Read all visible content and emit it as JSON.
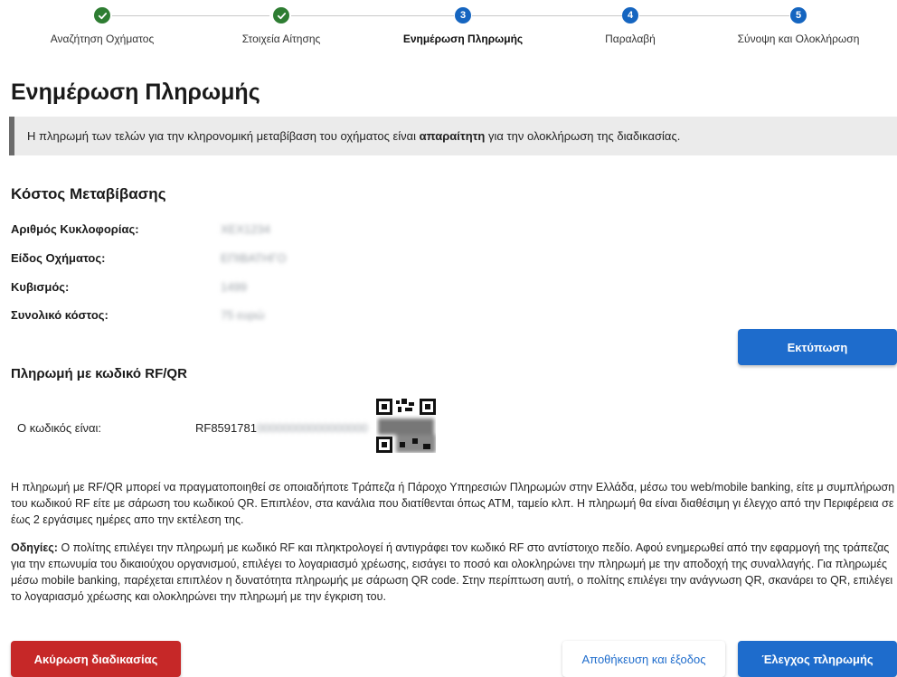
{
  "stepper": {
    "steps": [
      {
        "label": "Αναζήτηση Οχήματος",
        "state": "done",
        "number": "1"
      },
      {
        "label": "Στοιχεία Αίτησης",
        "state": "done",
        "number": "2"
      },
      {
        "label": "Ενημέρωση Πληρωμής",
        "state": "active",
        "number": "3"
      },
      {
        "label": "Παραλαβή",
        "state": "todo",
        "number": "4"
      },
      {
        "label": "Σύνοψη και Ολοκλήρωση",
        "state": "todo",
        "number": "5"
      }
    ]
  },
  "page": {
    "title": "Ενημέρωση Πληρωμής"
  },
  "banner": {
    "text_before": "Η πληρωμή των τελών για την κληρονομική μεταβίβαση του οχήματος είναι ",
    "text_bold": "απαραίτητη",
    "text_after": " για την ολοκλήρωση της διαδικασίας."
  },
  "cost": {
    "title": "Κόστος Μεταβίβασης",
    "rows": [
      {
        "label": "Αριθμός Κυκλοφορίας:",
        "value": "ΧΕΧ1234"
      },
      {
        "label": "Είδος Οχήματος:",
        "value": "ΕΠΙΒΑΤΗΓΟ"
      },
      {
        "label": "Κυβισμός:",
        "value": "1499"
      },
      {
        "label": "Συνολικό κόστος:",
        "value": "75 ευρώ"
      }
    ]
  },
  "buttons": {
    "print": "Εκτύπωση",
    "cancel": "Ακύρωση διαδικασίας",
    "save_exit": "Αποθήκευση και έξοδος",
    "check_payment": "Έλεγχος πληρωμής"
  },
  "rf": {
    "title": "Πληρωμή με κωδικό RF/QR",
    "label": "Ο κωδικός είναι:",
    "code_visible": "RF8591781",
    "code_hidden": "00000000000000000"
  },
  "paragraphs": {
    "p1": "Η πληρωμή με RF/QR μπορεί να πραγματοποιηθεί σε οποιαδήποτε Τράπεζα ή Πάροχο Υπηρεσιών Πληρωμών στην Ελλάδα, μέσω του web/mobile banking, είτε μ συμπλήρωση του κωδικού RF είτε με σάρωση του κωδικού QR. Επιπλέον, στα κανάλια που διατίθενται όπως ΑΤΜ, ταμείο κλπ. Η πληρωμή θα είναι διαθέσιμη γι έλεγχο από την Περιφέρεια σε έως 2 εργάσιμες ημέρες απο την εκτέλεση της.",
    "p2_bold": "Οδηγίες:",
    "p2": " Ο πολίτης επιλέγει την πληρωμή με κωδικό RF και πληκτρολογεί ή αντιγράφει τον κωδικό RF στο αντίστοιχο πεδίο. Αφού ενημερωθεί από την εφαρμογή της τράπεζας για την επωνυμία του δικαιούχου οργανισμού, επιλέγει το λογαριασμό χρέωσης, εισάγει το ποσό και ολοκληρώνει την πληρωμή με την αποδοχή της συναλλαγής. Για πληρωμές μέσω mobile banking, παρέχεται επιπλέον η δυνατότητα πληρωμής με σάρωση QR code. Στην περίπτωση αυτή, ο πολίτης επιλέγει την ανάγνωση QR, σκανάρει το QR, επιλέγει το λογαριασμό χρέωσης και ολοκληρώνει την πληρωμή με την έγκριση του."
  },
  "colors": {
    "primary": "#1e6ccc",
    "danger": "#c62828",
    "success": "#2e7d32",
    "banner_bg": "#ebebeb"
  }
}
